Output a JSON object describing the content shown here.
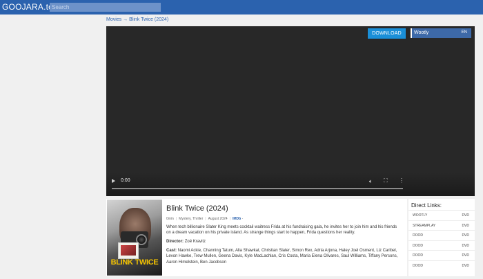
{
  "header": {
    "logo": "GOOJARA.to",
    "search_placeholder": "Search"
  },
  "breadcrumb": {
    "section": "Movies",
    "arrow": "→",
    "current": "Blink Twice (2024)"
  },
  "player": {
    "download_label": "DOWNLOAD",
    "server": {
      "name": "Wootly",
      "lang": "EN"
    },
    "time": "0:00",
    "progress": 0
  },
  "movie": {
    "poster_text": "BLINK TWICE",
    "title": "Blink Twice (2024)",
    "meta": {
      "runtime": "0min",
      "genres": "Mystery, Thriller",
      "date": "August 2024",
      "imdb": "IMDb",
      "imdb_rating": "-"
    },
    "description": "When tech billionaire Slater King meets cocktail waitress Frida at his fundraising gala, he invites her to join him and his friends on a dream vacation on his private island. As strange things start to happen, Frida questions her reality.",
    "director_label": "Director:",
    "director": "Zoë Kravitz",
    "cast_label": "Cast:",
    "cast": "Naomi Ackie, Channing Tatum, Alia Shawkat, Christian Slater, Simon Rex, Adria Arjona, Haley Joel Osment, Liz Caribel, Levon Hawke, Trew Mullen, Geena Davis, Kyle MacLachlan, Cris Costa, María Elena Olivares, Saul Williams, Tiffany Persons, Aaron Himelstein, Ben Jacobson"
  },
  "direct_links": {
    "title": "Direct Links:",
    "items": [
      {
        "host": "WOOTLY",
        "type": "DVD"
      },
      {
        "host": "STREAMPLAY",
        "type": "DVD"
      },
      {
        "host": "DOOD",
        "type": "DVD"
      },
      {
        "host": "DOOD",
        "type": "DVD"
      },
      {
        "host": "DOOD",
        "type": "DVD"
      },
      {
        "host": "DOOD",
        "type": "DVD"
      }
    ]
  }
}
